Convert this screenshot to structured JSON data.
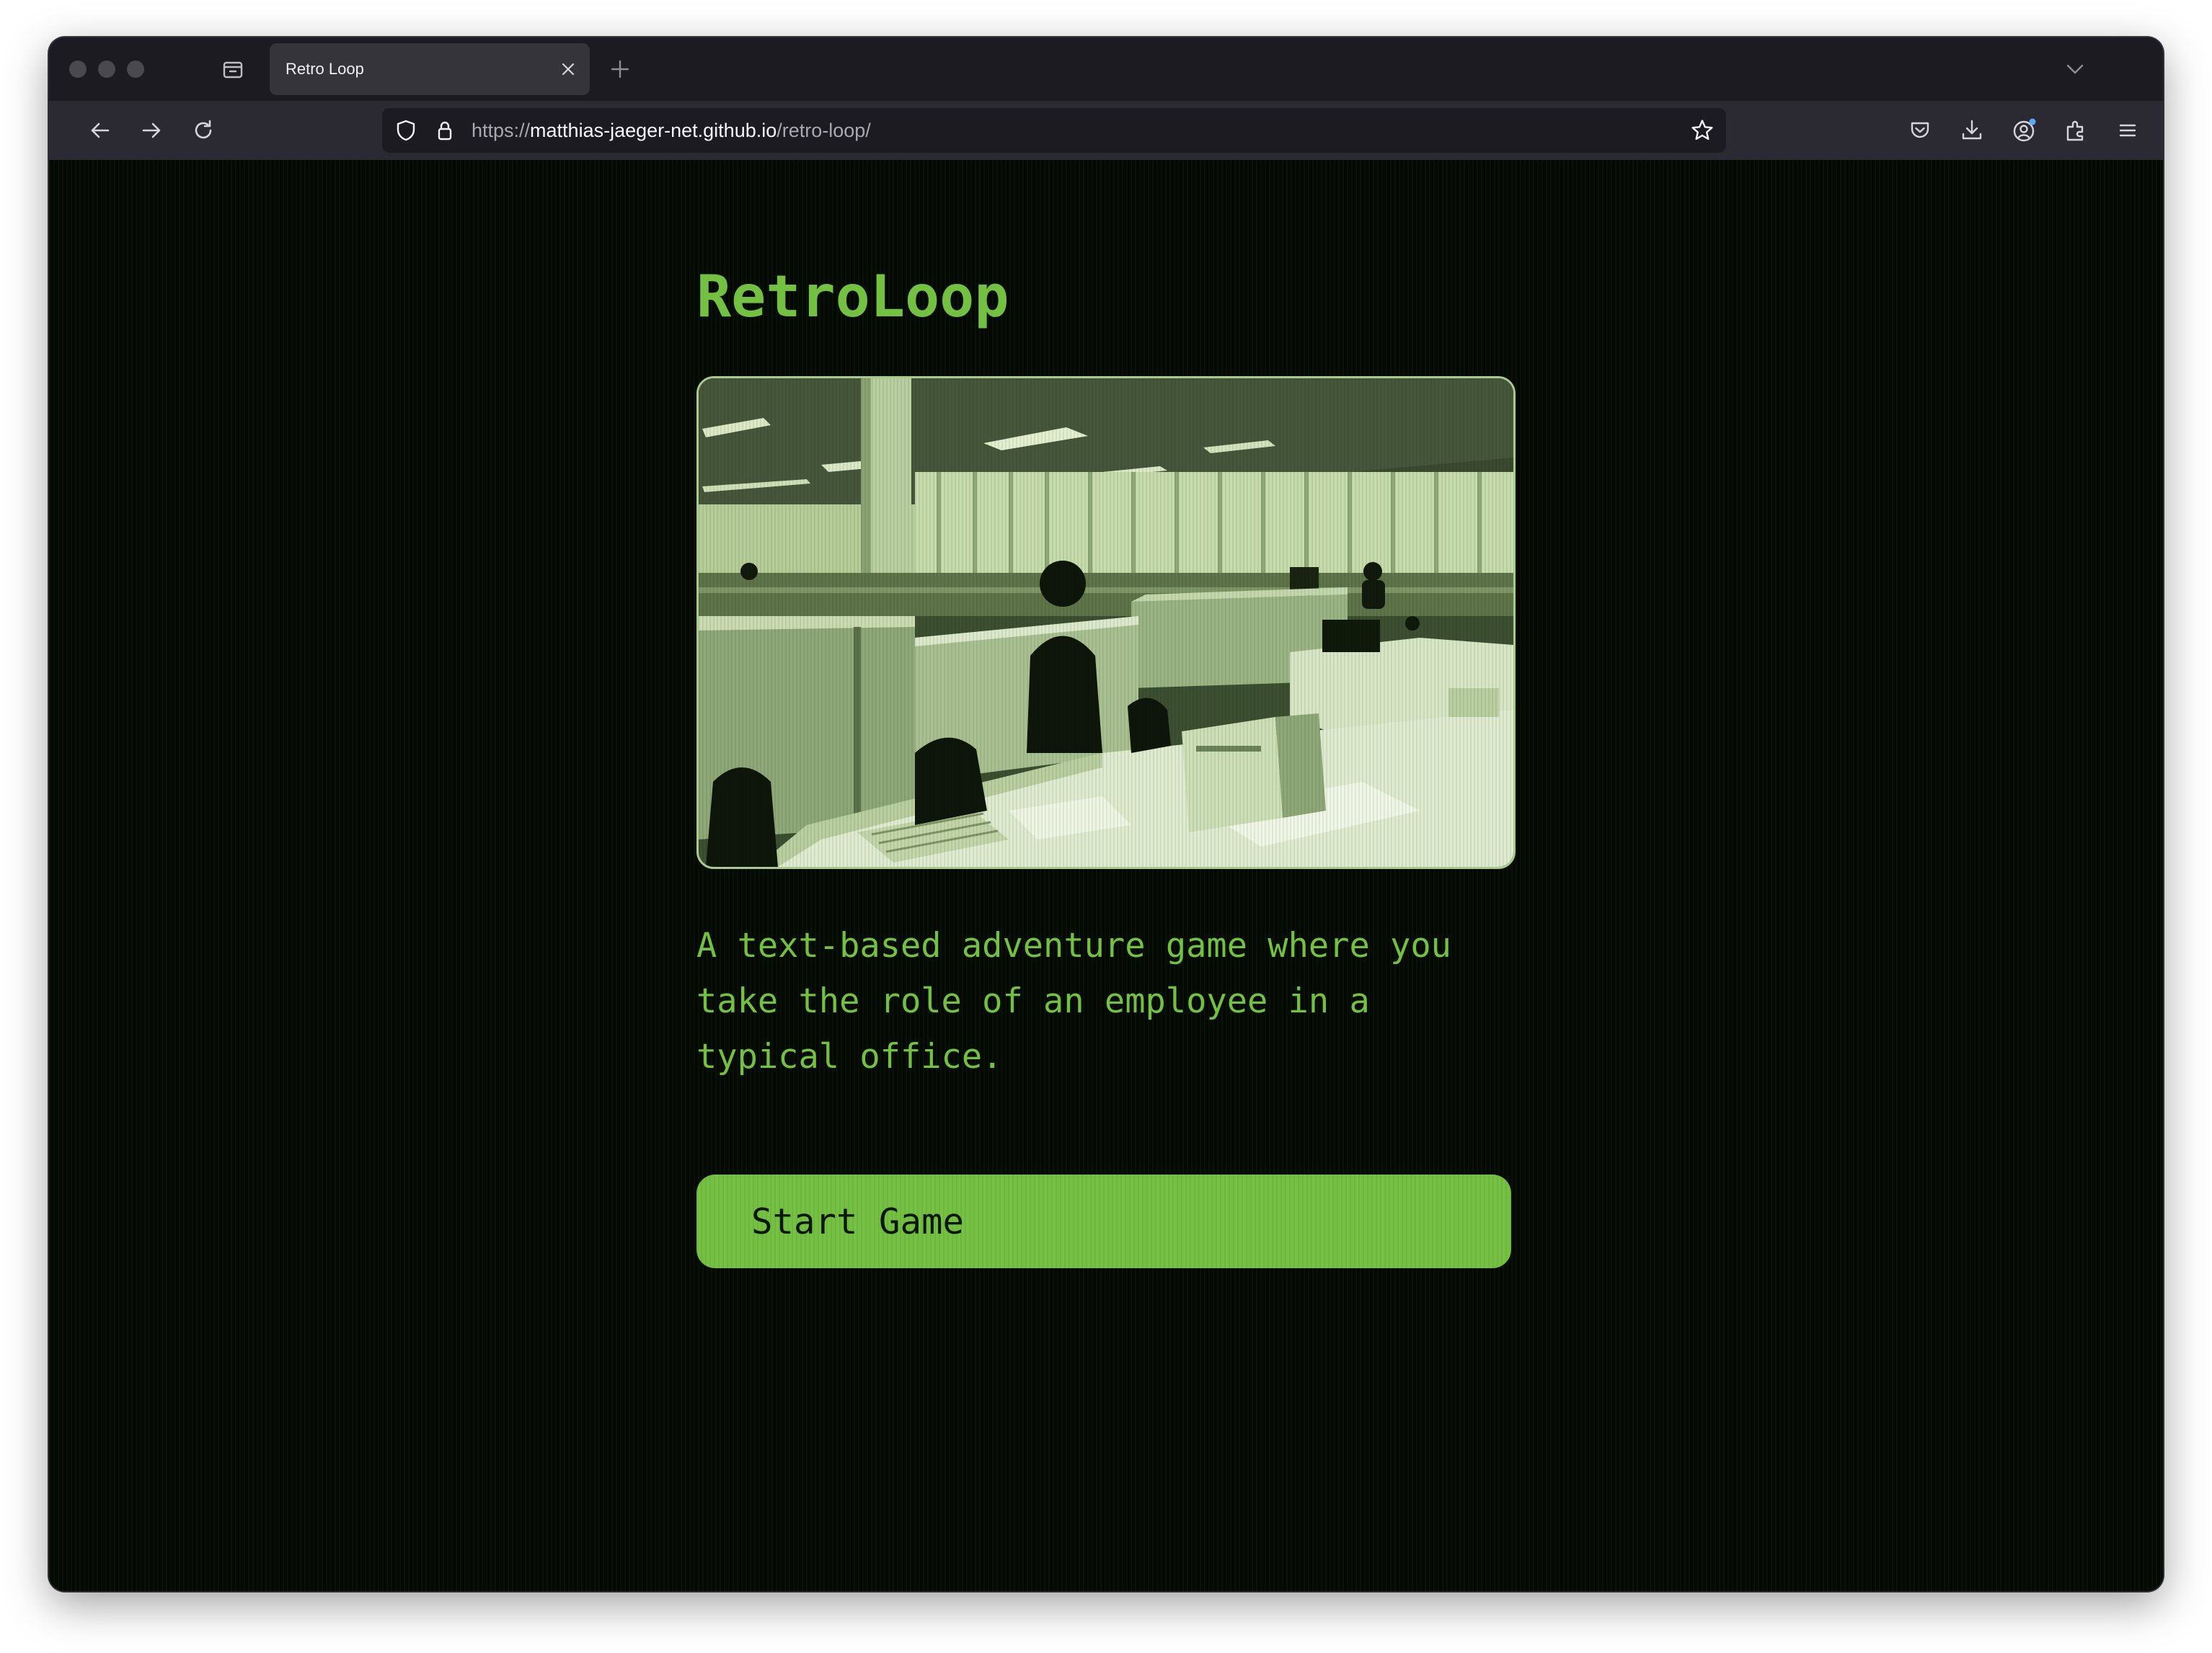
{
  "browser": {
    "tab": {
      "title": "Retro Loop"
    },
    "url": {
      "scheme": "https://",
      "host": "matthias-jaeger-net.github.io",
      "path": "/retro-loop/"
    }
  },
  "page": {
    "title": "RetroLoop",
    "description": "A text-based adventure game where you take the role of an employee in a typical office.",
    "start_button": "Start Game"
  },
  "colors": {
    "accent": "#74c043",
    "background": "#040a03",
    "button_text": "#0a1706"
  }
}
